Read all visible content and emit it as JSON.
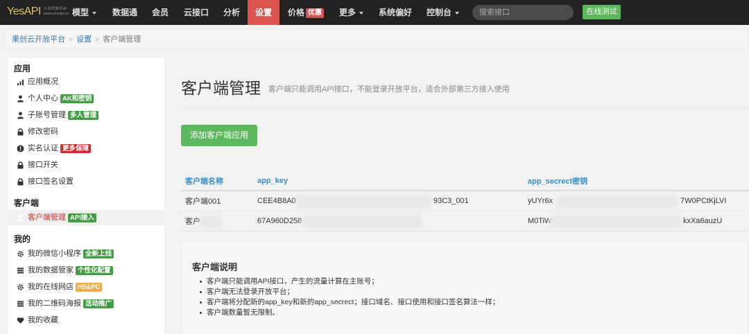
{
  "navbar": {
    "logo": "YesAPI",
    "logo_sub1": "小白开放平台",
    "logo_sub2": "www.yesapi.cn",
    "items": [
      {
        "label": "模型",
        "dropdown": true
      },
      {
        "label": "数据通",
        "dropdown": false
      },
      {
        "label": "会员",
        "dropdown": false
      },
      {
        "label": "云接口",
        "dropdown": false
      },
      {
        "label": "分析",
        "dropdown": false
      },
      {
        "label": "设置",
        "dropdown": false,
        "active": true
      },
      {
        "label": "价格",
        "dropdown": false,
        "badge": "优惠"
      },
      {
        "label": "更多",
        "dropdown": true
      },
      {
        "label": "系统偏好",
        "dropdown": false
      },
      {
        "label": "控制台",
        "dropdown": true
      }
    ],
    "search_placeholder": "搜索接口",
    "test_button": "在线测试"
  },
  "breadcrumb": {
    "home": "果创云开放平台",
    "section": "设置",
    "current": "客户端管理",
    "separator": "»"
  },
  "sidebar": {
    "sections": [
      {
        "heading": "应用",
        "items": [
          {
            "label": "应用概况",
            "icon": "bar-chart-icon"
          },
          {
            "label": "个人中心",
            "icon": "user-icon",
            "badge": "AK和密钥",
            "badge_color": "green"
          },
          {
            "label": "子账号管理",
            "icon": "user-icon",
            "badge": "多人管理",
            "badge_color": "green"
          },
          {
            "label": "修改密码",
            "icon": "lock-icon"
          },
          {
            "label": "实名认证",
            "icon": "alert-circle-icon",
            "badge": "更多保障",
            "badge_color": "red"
          },
          {
            "label": "接口开关",
            "icon": "lock-icon"
          },
          {
            "label": "接口签名设置",
            "icon": "lock-icon"
          }
        ]
      },
      {
        "heading": "客户端",
        "items": [
          {
            "label": "客户端管理",
            "icon": "user-icon",
            "badge": "API接入",
            "badge_color": "green",
            "active": true
          }
        ]
      },
      {
        "heading": "我的",
        "items": [
          {
            "label": "我的微信小程序",
            "icon": "gear-icon",
            "badge": "全新上线",
            "badge_color": "green"
          },
          {
            "label": "我的数据管家",
            "icon": "list-icon",
            "badge": "个性化配置",
            "badge_color": "green"
          },
          {
            "label": "我的在线网店",
            "icon": "gear-icon",
            "badge": "H5&PC",
            "badge_color": "orange"
          },
          {
            "label": "我的二维码海报",
            "icon": "list-icon",
            "badge": "活动推广",
            "badge_color": "green"
          },
          {
            "label": "我的收藏",
            "icon": "heart-icon"
          }
        ]
      }
    ]
  },
  "main": {
    "title": "客户端管理",
    "subtitle": "客户端只能调用API接口，不能登录开放平台，适合外部第三方接入使用",
    "add_button": "添加客户端应用",
    "table": {
      "headers": [
        "客户端名称",
        "app_key",
        "app_secrect密钥"
      ],
      "rows": [
        {
          "name": "客户端001",
          "app_key_start": "CEE4B8A0",
          "app_key_end": "93C3_001",
          "secret_start": "yUYr6x",
          "secret_end": "7W0PCtKjLVI"
        },
        {
          "name": "客户",
          "app_key_start": "67A960D258",
          "app_key_end": "",
          "secret_start": "M0TiW",
          "secret_end": "kxXa6auzU"
        }
      ]
    },
    "description": {
      "title": "客户端说明",
      "items": [
        "客户端只能调用API接口，产生的流量计算在主账号；",
        "客户端无法登录开放平台；",
        "客户端将分配新的app_key和新的app_secrect；接口域名、接口使用和接口签名算法一样；",
        "客户端数量暂无限制。"
      ]
    }
  }
}
